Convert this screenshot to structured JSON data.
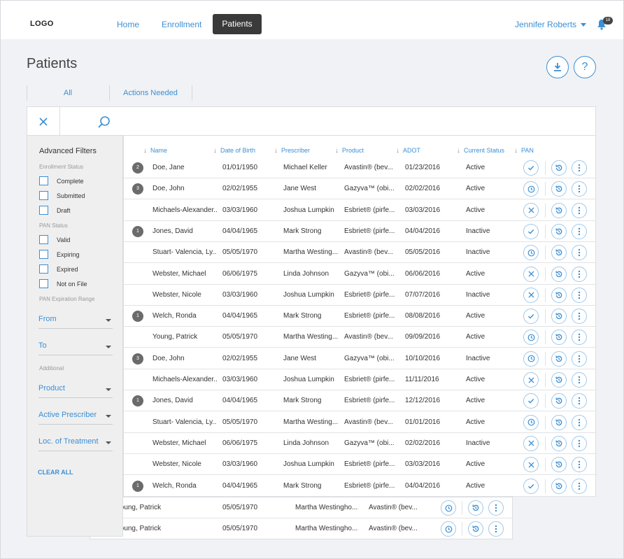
{
  "nav": {
    "logo": "LOGO",
    "links": [
      "Home",
      "Enrollment"
    ],
    "active": "Patients",
    "user": "Jennifer Roberts",
    "notification_count": "18"
  },
  "page": {
    "title": "Patients",
    "tabs": [
      "All",
      "Actions Needed"
    ]
  },
  "filters": {
    "title": "Advanced Filters",
    "enrollment_status_label": "Enrollment Status",
    "enrollment_status": [
      "Complete",
      "Submitted",
      "Draft"
    ],
    "pan_status_label": "PAN Status",
    "pan_status": [
      "Valid",
      "Expiring",
      "Expired",
      "Not on File"
    ],
    "pan_range_label": "PAN Expiration Range",
    "from": "From",
    "to": "To",
    "additional_label": "Additional",
    "product": "Product",
    "active_prescriber": "Active Prescriber",
    "loc_treatment": "Loc. of Treatment",
    "clear_all": "CLEAR ALL"
  },
  "table": {
    "headers": [
      "Name",
      "Date of Birth",
      "Prescriber",
      "Product",
      "ADOT",
      "Current Status",
      "PAN"
    ],
    "rows": [
      {
        "badge": "2",
        "name": "Doe, Jane",
        "dob": "01/01/1950",
        "prescriber": "Michael Keller",
        "product": "Avastin® (bev...",
        "adot": "01/23/2016",
        "status": "Active",
        "pan": "check"
      },
      {
        "badge": "3",
        "name": "Doe, John",
        "dob": "02/02/1955",
        "prescriber": "Jane West",
        "product": "Gazyva™ (obi...",
        "adot": "02/02/2016",
        "status": "Active",
        "pan": "clock"
      },
      {
        "badge": "",
        "name": "Michaels-Alexander...",
        "dob": "03/03/1960",
        "prescriber": "Joshua Lumpkin",
        "product": "Esbriet® (pirfe...",
        "adot": "03/03/2016",
        "status": "Active",
        "pan": "x"
      },
      {
        "badge": "1",
        "name": "Jones, David",
        "dob": "04/04/1965",
        "prescriber": "Mark Strong",
        "product": "Esbriet® (pirfe...",
        "adot": "04/04/2016",
        "status": "Inactive",
        "pan": "check"
      },
      {
        "badge": "",
        "name": "Stuart- Valencia, Ly...",
        "dob": "05/05/1970",
        "prescriber": "Martha Westing...",
        "product": "Avastin® (bev...",
        "adot": "05/05/2016",
        "status": "Inactive",
        "pan": "clock"
      },
      {
        "badge": "",
        "name": "Webster, Michael",
        "dob": "06/06/1975",
        "prescriber": "Linda Johnson",
        "product": "Gazyva™ (obi...",
        "adot": "06/06/2016",
        "status": "Active",
        "pan": "x"
      },
      {
        "badge": "",
        "name": "Webster, Nicole",
        "dob": "03/03/1960",
        "prescriber": "Joshua Lumpkin",
        "product": "Esbriet® (pirfe...",
        "adot": "07/07/2016",
        "status": "Inactive",
        "pan": "x"
      },
      {
        "badge": "1",
        "name": "Welch, Ronda",
        "dob": "04/04/1965",
        "prescriber": "Mark Strong",
        "product": "Esbriet® (pirfe...",
        "adot": "08/08/2016",
        "status": "Active",
        "pan": "check"
      },
      {
        "badge": "",
        "name": "Young, Patrick",
        "dob": "05/05/1970",
        "prescriber": "Martha Westing...",
        "product": "Avastin® (bev...",
        "adot": "09/09/2016",
        "status": "Active",
        "pan": "clock"
      },
      {
        "badge": "3",
        "name": "Doe, John",
        "dob": "02/02/1955",
        "prescriber": "Jane West",
        "product": "Gazyva™ (obi...",
        "adot": "10/10/2016",
        "status": "Inactive",
        "pan": "clock"
      },
      {
        "badge": "",
        "name": "Michaels-Alexander...",
        "dob": "03/03/1960",
        "prescriber": "Joshua Lumpkin",
        "product": "Esbriet® (pirfe...",
        "adot": "11/11/2016",
        "status": "Active",
        "pan": "x"
      },
      {
        "badge": "1",
        "name": "Jones, David",
        "dob": "04/04/1965",
        "prescriber": "Mark Strong",
        "product": "Esbriet® (pirfe...",
        "adot": "12/12/2016",
        "status": "Active",
        "pan": "check"
      },
      {
        "badge": "",
        "name": "Stuart- Valencia, Ly...",
        "dob": "05/05/1970",
        "prescriber": "Martha Westing...",
        "product": "Avastin® (bev...",
        "adot": "01/01/2016",
        "status": "Active",
        "pan": "clock"
      },
      {
        "badge": "",
        "name": "Webster, Michael",
        "dob": "06/06/1975",
        "prescriber": "Linda Johnson",
        "product": "Gazyva™ (obi...",
        "adot": "02/02/2016",
        "status": "Inactive",
        "pan": "x"
      },
      {
        "badge": "",
        "name": "Webster, Nicole",
        "dob": "03/03/1960",
        "prescriber": "Joshua Lumpkin",
        "product": "Esbriet® (pirfe...",
        "adot": "03/03/2016",
        "status": "Active",
        "pan": "x"
      },
      {
        "badge": "1",
        "name": "Welch, Ronda",
        "dob": "04/04/1965",
        "prescriber": "Mark Strong",
        "product": "Esbriet® (pirfe...",
        "adot": "04/04/2016",
        "status": "Active",
        "pan": "check"
      }
    ],
    "under_rows": [
      {
        "name": "Young, Patrick",
        "dob": "05/05/1970",
        "prescriber": "Martha Westingho...",
        "product": "Avastin® (bev..."
      },
      {
        "name": "Young, Patrick",
        "dob": "05/05/1970",
        "prescriber": "Martha Westingho...",
        "product": "Avastin® (bev..."
      }
    ]
  },
  "colors": {
    "accent": "#3b8fd4",
    "active_nav": "#3a3a3a",
    "badge": "#6b6b6b"
  }
}
